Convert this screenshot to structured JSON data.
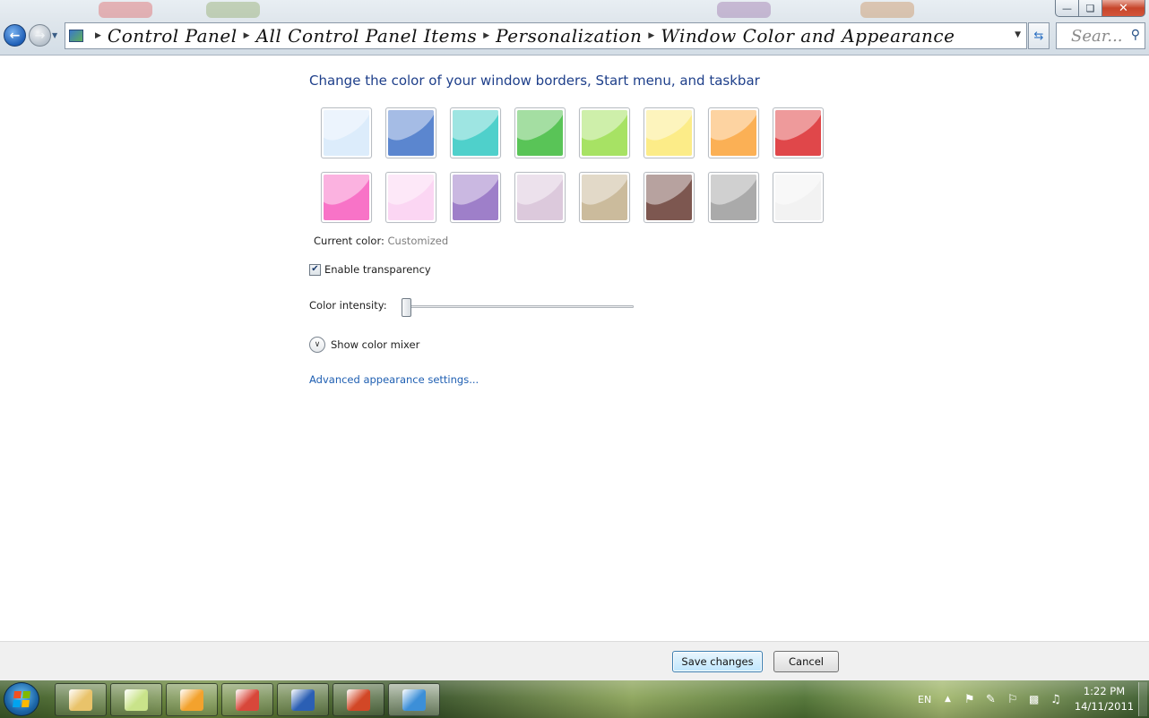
{
  "window": {
    "minimize_icon": "minimize-icon",
    "maximize_icon": "maximize-icon",
    "close_icon": "close-icon"
  },
  "address": {
    "breadcrumbs": [
      "Control Panel",
      "All Control Panel Items",
      "Personalization",
      "Window Color and Appearance"
    ],
    "search_placeholder": "Sear..."
  },
  "content": {
    "heading": "Change the color of your window borders, Start menu, and taskbar",
    "swatches": [
      {
        "name": "sky",
        "color": "#dcecfb"
      },
      {
        "name": "twilight",
        "color": "#5b86cf"
      },
      {
        "name": "sea",
        "color": "#4fd0cb"
      },
      {
        "name": "leaf",
        "color": "#59c457"
      },
      {
        "name": "lime",
        "color": "#a7e264"
      },
      {
        "name": "sun",
        "color": "#fcec88"
      },
      {
        "name": "pumpkin",
        "color": "#fbb055"
      },
      {
        "name": "ruby",
        "color": "#e0474a"
      },
      {
        "name": "fuchsia",
        "color": "#f873c7"
      },
      {
        "name": "blush",
        "color": "#fbd6f3"
      },
      {
        "name": "violet",
        "color": "#9e7fc9"
      },
      {
        "name": "lavender",
        "color": "#dcc9dc"
      },
      {
        "name": "taupe",
        "color": "#cbbb9c"
      },
      {
        "name": "chocolate",
        "color": "#7d5750"
      },
      {
        "name": "slate",
        "color": "#aaaaaa"
      },
      {
        "name": "frost",
        "color": "#f2f2f2"
      }
    ],
    "current_color_label": "Current color:",
    "current_color_value": "Customized",
    "transparency_label": "Enable transparency",
    "transparency_checked": true,
    "intensity_label": "Color intensity:",
    "intensity_value": 0.0,
    "mixer_label": "Show color mixer",
    "advanced_link": "Advanced appearance settings..."
  },
  "footer": {
    "save_label": "Save changes",
    "cancel_label": "Cancel"
  },
  "taskbar": {
    "apps": [
      {
        "name": "windows-explorer",
        "color": "#e9c36a"
      },
      {
        "name": "sticky-notes",
        "color": "#c9e38a"
      },
      {
        "name": "picasa",
        "color": "#f3a22d"
      },
      {
        "name": "google-chrome",
        "color": "#d8473a"
      },
      {
        "name": "microsoft-word",
        "color": "#2b5fb4"
      },
      {
        "name": "microsoft-powerpoint",
        "color": "#d24726"
      },
      {
        "name": "control-panel",
        "color": "#3c8fd8"
      }
    ],
    "language": "EN",
    "time": "1:22 PM",
    "date": "14/11/2011"
  }
}
